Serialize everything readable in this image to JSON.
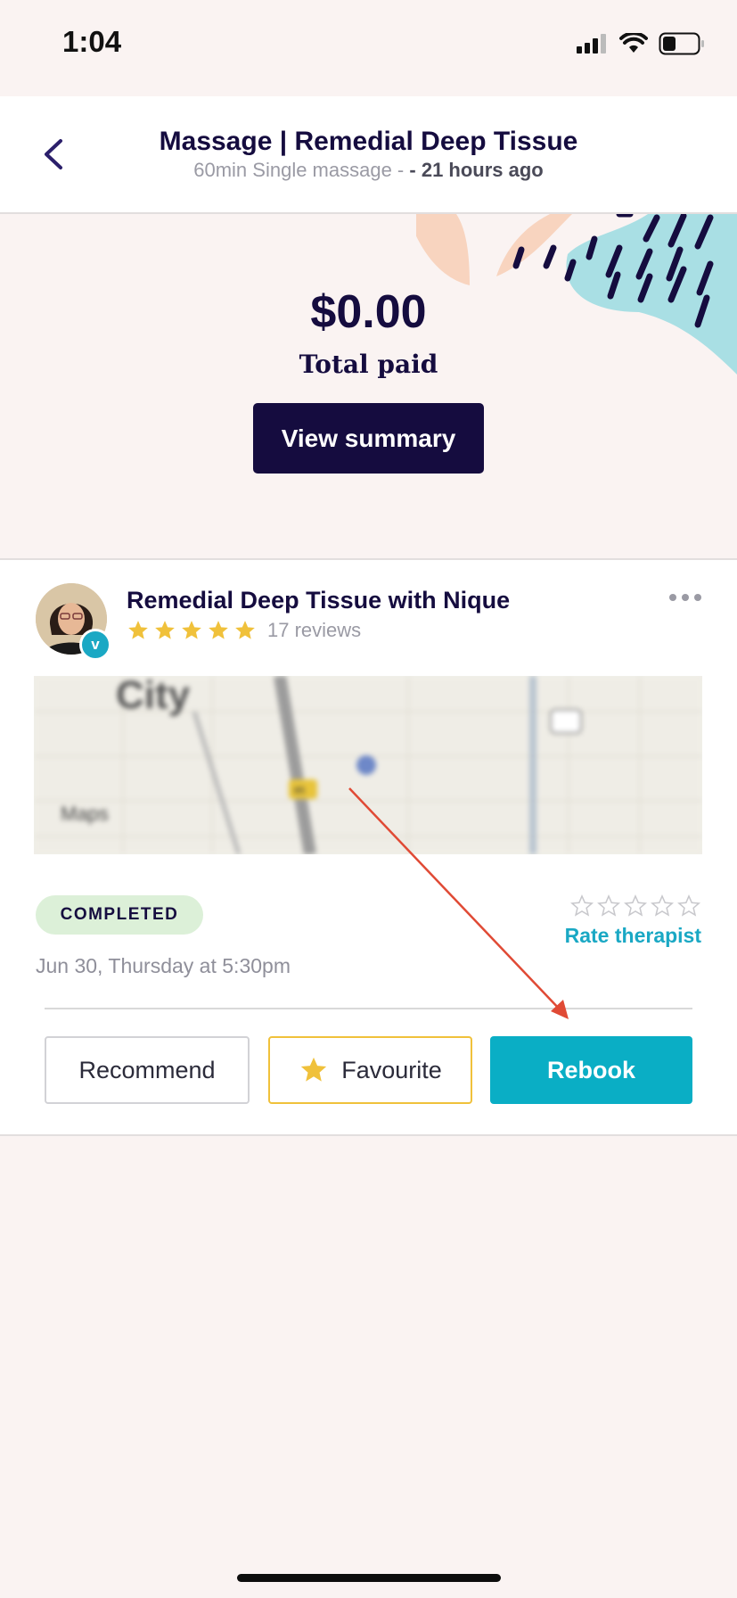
{
  "status_bar": {
    "time": "1:04"
  },
  "header": {
    "title": "Massage | Remedial Deep Tissue",
    "subtitle": "60min Single massage -",
    "time_ago": "- 21 hours ago"
  },
  "payment": {
    "amount": "$0.00",
    "label": "Total paid",
    "view_summary_label": "View summary"
  },
  "booking": {
    "therapist_title": "Remedial Deep Tissue with Nique",
    "rating": 5,
    "reviews_label": "17 reviews",
    "avatar_badge": "v",
    "map_labels": {
      "city": "City",
      "maps": "Maps",
      "route": "85"
    },
    "status": "COMPLETED",
    "date": "Jun 30, Thursday at 5:30pm",
    "rate_label": "Rate therapist",
    "rate_value": 0,
    "actions": {
      "recommend": "Recommend",
      "favourite": "Favourite",
      "rebook": "Rebook"
    }
  },
  "colors": {
    "navy": "#150c3f",
    "teal": "#0aaec5",
    "star": "#f0c13b",
    "completed_bg": "#dcf0d8",
    "annotation_arrow": "#e04a35"
  }
}
